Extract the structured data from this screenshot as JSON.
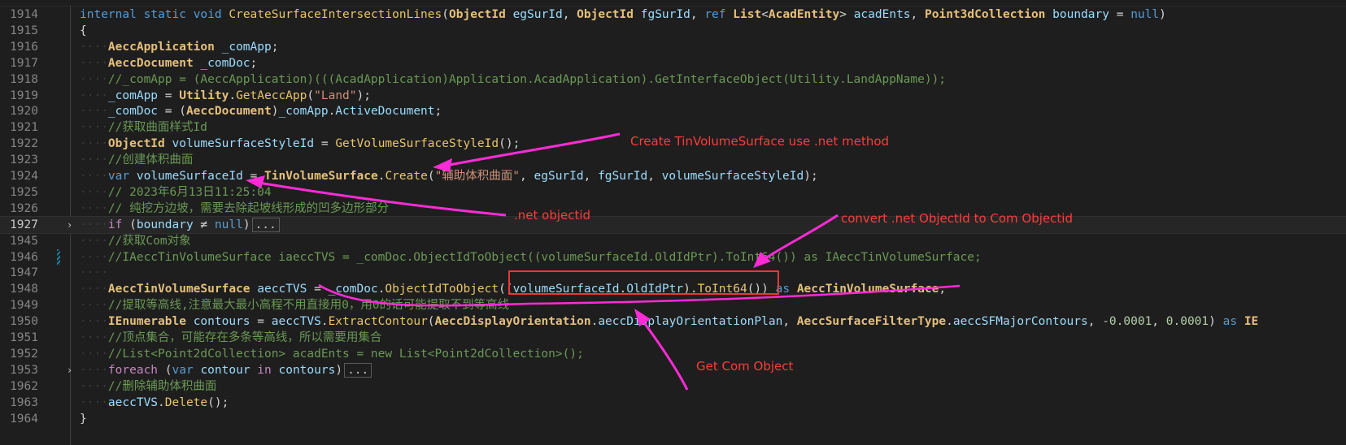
{
  "editor": {
    "lines": [
      {
        "num": "1914",
        "tokens": [
          {
            "t": "kw",
            "v": "internal"
          },
          {
            "t": "pl",
            "v": " "
          },
          {
            "t": "kw",
            "v": "static"
          },
          {
            "t": "pl",
            "v": " "
          },
          {
            "t": "kw",
            "v": "void"
          },
          {
            "t": "pl",
            "v": " "
          },
          {
            "t": "fnb",
            "v": "CreateSurfaceIntersectionLines"
          },
          {
            "t": "pl",
            "v": "("
          },
          {
            "t": "cls",
            "v": "ObjectId"
          },
          {
            "t": "pl",
            "v": " "
          },
          {
            "t": "var",
            "v": "egSurId"
          },
          {
            "t": "pl",
            "v": ", "
          },
          {
            "t": "cls",
            "v": "ObjectId"
          },
          {
            "t": "pl",
            "v": " "
          },
          {
            "t": "var",
            "v": "fgSurId"
          },
          {
            "t": "pl",
            "v": ", "
          },
          {
            "t": "kw",
            "v": "ref"
          },
          {
            "t": "pl",
            "v": " "
          },
          {
            "t": "cls",
            "v": "List"
          },
          {
            "t": "pl",
            "v": "<"
          },
          {
            "t": "cls",
            "v": "AcadEntity"
          },
          {
            "t": "pl",
            "v": "> "
          },
          {
            "t": "var",
            "v": "acadEnts"
          },
          {
            "t": "pl",
            "v": ", "
          },
          {
            "t": "cls",
            "v": "Point3dCollection"
          },
          {
            "t": "pl",
            "v": " "
          },
          {
            "t": "var",
            "v": "boundary"
          },
          {
            "t": "pl",
            "v": " = "
          },
          {
            "t": "kw",
            "v": "null"
          },
          {
            "t": "pl",
            "v": ")"
          }
        ]
      },
      {
        "num": "1915",
        "tokens": [
          {
            "t": "pl",
            "v": "{"
          }
        ]
      },
      {
        "num": "1916",
        "tokens": [
          {
            "t": "ind",
            "v": "····"
          },
          {
            "t": "cls",
            "v": "AeccApplication"
          },
          {
            "t": "pl",
            "v": " "
          },
          {
            "t": "var",
            "v": "_comApp"
          },
          {
            "t": "pl",
            "v": ";"
          }
        ]
      },
      {
        "num": "1917",
        "tokens": [
          {
            "t": "ind",
            "v": "····"
          },
          {
            "t": "cls",
            "v": "AeccDocument"
          },
          {
            "t": "pl",
            "v": " "
          },
          {
            "t": "var",
            "v": "_comDoc"
          },
          {
            "t": "pl",
            "v": ";"
          }
        ]
      },
      {
        "num": "1918",
        "tokens": [
          {
            "t": "ind",
            "v": "····"
          },
          {
            "t": "cm",
            "v": "//_comApp = (AeccApplication)(((AcadApplication)Application.AcadApplication).GetInterfaceObject(Utility.LandAppName));"
          }
        ]
      },
      {
        "num": "1919",
        "tokens": [
          {
            "t": "ind",
            "v": "····"
          },
          {
            "t": "var",
            "v": "_comApp"
          },
          {
            "t": "pl",
            "v": " = "
          },
          {
            "t": "cls",
            "v": "Utility"
          },
          {
            "t": "pl",
            "v": "."
          },
          {
            "t": "fnb",
            "v": "GetAeccApp"
          },
          {
            "t": "pl",
            "v": "("
          },
          {
            "t": "str",
            "v": "\"Land\""
          },
          {
            "t": "pl",
            "v": ");"
          }
        ]
      },
      {
        "num": "1920",
        "tokens": [
          {
            "t": "ind",
            "v": "····"
          },
          {
            "t": "var",
            "v": "_comDoc"
          },
          {
            "t": "pl",
            "v": " = ("
          },
          {
            "t": "cls",
            "v": "AeccDocument"
          },
          {
            "t": "pl",
            "v": ")"
          },
          {
            "t": "var",
            "v": "_comApp"
          },
          {
            "t": "pl",
            "v": "."
          },
          {
            "t": "var",
            "v": "ActiveDocument"
          },
          {
            "t": "pl",
            "v": ";"
          }
        ]
      },
      {
        "num": "1921",
        "tokens": [
          {
            "t": "ind",
            "v": "····"
          },
          {
            "t": "cm",
            "v": "//获取曲面样式Id"
          }
        ]
      },
      {
        "num": "1922",
        "tokens": [
          {
            "t": "ind",
            "v": "····"
          },
          {
            "t": "cls",
            "v": "ObjectId"
          },
          {
            "t": "pl",
            "v": " "
          },
          {
            "t": "var",
            "v": "volumeSurfaceStyleId"
          },
          {
            "t": "pl",
            "v": " = "
          },
          {
            "t": "fnb",
            "v": "GetVolumeSurfaceStyleId"
          },
          {
            "t": "pl",
            "v": "();"
          }
        ]
      },
      {
        "num": "1923",
        "tokens": [
          {
            "t": "ind",
            "v": "····"
          },
          {
            "t": "cm",
            "v": "//创建体积曲面"
          }
        ]
      },
      {
        "num": "1924",
        "tokens": [
          {
            "t": "ind",
            "v": "····"
          },
          {
            "t": "kw",
            "v": "var"
          },
          {
            "t": "pl",
            "v": " "
          },
          {
            "t": "var",
            "v": "volumeSurfaceId"
          },
          {
            "t": "pl",
            "v": " = "
          },
          {
            "t": "cls",
            "v": "TinVolumeSurface"
          },
          {
            "t": "pl",
            "v": "."
          },
          {
            "t": "fnb",
            "v": "Create"
          },
          {
            "t": "pl",
            "v": "("
          },
          {
            "t": "str",
            "v": "\"辅助体积曲面\""
          },
          {
            "t": "pl",
            "v": ", "
          },
          {
            "t": "var",
            "v": "egSurId"
          },
          {
            "t": "pl",
            "v": ", "
          },
          {
            "t": "var",
            "v": "fgSurId"
          },
          {
            "t": "pl",
            "v": ", "
          },
          {
            "t": "var",
            "v": "volumeSurfaceStyleId"
          },
          {
            "t": "pl",
            "v": ");"
          }
        ]
      },
      {
        "num": "1925",
        "tokens": [
          {
            "t": "ind",
            "v": "····"
          },
          {
            "t": "cm",
            "v": "// 2023年6月13日11:25:04"
          }
        ]
      },
      {
        "num": "1926",
        "tokens": [
          {
            "t": "ind",
            "v": "····"
          },
          {
            "t": "cm",
            "v": "// 纯挖方边坡，需要去除起坡线形成的凹多边形部分"
          }
        ]
      },
      {
        "num": "1927",
        "current": true,
        "fold": true,
        "tokens": [
          {
            "t": "ind",
            "v": "····"
          },
          {
            "t": "ctl",
            "v": "if"
          },
          {
            "t": "pl",
            "v": " ("
          },
          {
            "t": "var",
            "v": "boundary"
          },
          {
            "t": "pl",
            "v": " ≠ "
          },
          {
            "t": "kw",
            "v": "null"
          },
          {
            "t": "pl",
            "v": ")"
          }
        ],
        "collapsed": "..."
      },
      {
        "num": "1945",
        "tokens": [
          {
            "t": "ind",
            "v": "····"
          },
          {
            "t": "cm",
            "v": "//获取Com对象"
          }
        ]
      },
      {
        "num": "1946",
        "modified": true,
        "tokens": [
          {
            "t": "ind",
            "v": "····"
          },
          {
            "t": "cm",
            "v": "//IAeccTinVolumeSurface iaeccTVS = _comDoc.ObjectIdToObject((volumeSurfaceId.OldIdPtr).ToInt64()) as IAeccTinVolumeSurface;"
          }
        ]
      },
      {
        "num": "1947",
        "tokens": [
          {
            "t": "ind",
            "v": "····"
          }
        ]
      },
      {
        "num": "1948",
        "tokens": [
          {
            "t": "ind",
            "v": "····"
          },
          {
            "t": "cls",
            "v": "AeccTinVolumeSurface"
          },
          {
            "t": "pl",
            "v": " "
          },
          {
            "t": "var",
            "v": "aeccTVS"
          },
          {
            "t": "pl",
            "v": " = "
          },
          {
            "t": "var",
            "v": "_comDoc"
          },
          {
            "t": "pl",
            "v": "."
          },
          {
            "t": "fnb",
            "v": "ObjectIdToObject"
          },
          {
            "t": "pl",
            "v": "(("
          },
          {
            "t": "var",
            "v": "volumeSurfaceId"
          },
          {
            "t": "pl",
            "v": "."
          },
          {
            "t": "var",
            "v": "OldIdPtr"
          },
          {
            "t": "pl",
            "v": ")."
          },
          {
            "t": "fnb",
            "v": "ToInt64"
          },
          {
            "t": "pl",
            "v": "()) "
          },
          {
            "t": "kw",
            "v": "as"
          },
          {
            "t": "pl",
            "v": " "
          },
          {
            "t": "cls",
            "v": "AeccTinVolumeSurface"
          },
          {
            "t": "pl",
            "v": ";"
          }
        ]
      },
      {
        "num": "1949",
        "tokens": [
          {
            "t": "ind",
            "v": "····"
          },
          {
            "t": "cm",
            "v": "//提取等高线,注意最大最小高程不用直接用0，用0的话可能提取不到等高线"
          }
        ]
      },
      {
        "num": "1950",
        "tokens": [
          {
            "t": "ind",
            "v": "····"
          },
          {
            "t": "cls",
            "v": "IEnumerable"
          },
          {
            "t": "pl",
            "v": " "
          },
          {
            "t": "var",
            "v": "contours"
          },
          {
            "t": "pl",
            "v": " = "
          },
          {
            "t": "var",
            "v": "aeccTVS"
          },
          {
            "t": "pl",
            "v": "."
          },
          {
            "t": "fnb",
            "v": "ExtractContour"
          },
          {
            "t": "pl",
            "v": "("
          },
          {
            "t": "cls",
            "v": "AeccDisplayOrientation"
          },
          {
            "t": "pl",
            "v": "."
          },
          {
            "t": "var",
            "v": "aeccDisplayOrientationPlan"
          },
          {
            "t": "pl",
            "v": ", "
          },
          {
            "t": "cls",
            "v": "AeccSurfaceFilterType"
          },
          {
            "t": "pl",
            "v": "."
          },
          {
            "t": "var",
            "v": "aeccSFMajorContours"
          },
          {
            "t": "pl",
            "v": ", "
          },
          {
            "t": "num",
            "v": "-0.0001"
          },
          {
            "t": "pl",
            "v": ", "
          },
          {
            "t": "num",
            "v": "0.0001"
          },
          {
            "t": "pl",
            "v": ") "
          },
          {
            "t": "kw",
            "v": "as"
          },
          {
            "t": "pl",
            "v": " "
          },
          {
            "t": "cls",
            "v": "IE"
          }
        ]
      },
      {
        "num": "1951",
        "tokens": [
          {
            "t": "ind",
            "v": "····"
          },
          {
            "t": "cm",
            "v": "//顶点集合，可能存在多条等高线，所以需要用集合"
          }
        ]
      },
      {
        "num": "1952",
        "tokens": [
          {
            "t": "ind",
            "v": "····"
          },
          {
            "t": "cm",
            "v": "//List<Point2dCollection> acadEnts = new List<Point2dCollection>();"
          }
        ]
      },
      {
        "num": "1953",
        "fold": true,
        "tokens": [
          {
            "t": "ind",
            "v": "····"
          },
          {
            "t": "ctl",
            "v": "foreach"
          },
          {
            "t": "pl",
            "v": " ("
          },
          {
            "t": "kw",
            "v": "var"
          },
          {
            "t": "pl",
            "v": " "
          },
          {
            "t": "var",
            "v": "contour"
          },
          {
            "t": "pl",
            "v": " "
          },
          {
            "t": "ctl",
            "v": "in"
          },
          {
            "t": "pl",
            "v": " "
          },
          {
            "t": "var",
            "v": "contours"
          },
          {
            "t": "pl",
            "v": ")"
          }
        ],
        "collapsed": "..."
      },
      {
        "num": "1962",
        "tokens": [
          {
            "t": "ind",
            "v": "····"
          },
          {
            "t": "cm",
            "v": "//删除辅助体积曲面"
          }
        ]
      },
      {
        "num": "1963",
        "tokens": [
          {
            "t": "ind",
            "v": "····"
          },
          {
            "t": "var",
            "v": "aeccTVS"
          },
          {
            "t": "pl",
            "v": "."
          },
          {
            "t": "fnb",
            "v": "Delete"
          },
          {
            "t": "pl",
            "v": "();"
          }
        ]
      },
      {
        "num": "1964",
        "tokens": [
          {
            "t": "pl",
            "v": "}"
          }
        ]
      }
    ]
  },
  "annotations": {
    "create_tin": "Create TinVolumeSurface use .net method",
    "net_objectid": ".net objectid",
    "convert": "convert .net ObjectId to Com Objectid",
    "get_com": "Get Com Object"
  },
  "colors": {
    "annotation_text": "#ff3b3b",
    "arrow": "#ff2bd6",
    "highlight_box": "#e53935"
  }
}
